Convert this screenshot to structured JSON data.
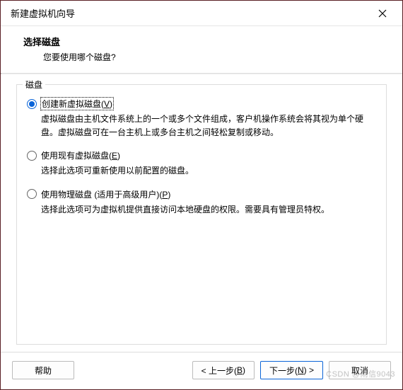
{
  "window": {
    "title": "新建虚拟机向导"
  },
  "header": {
    "title": "选择磁盘",
    "subtitle": "您要使用哪个磁盘?"
  },
  "group": {
    "label": "磁盘"
  },
  "options": [
    {
      "label_pre": "创建新虚拟磁盘(",
      "label_accel": "V",
      "label_post": ")",
      "selected": true,
      "desc": "虚拟磁盘由主机文件系统上的一个或多个文件组成，客户机操作系统会将其视为单个硬盘。虚拟磁盘可在一台主机上或多台主机之间轻松复制或移动。"
    },
    {
      "label_pre": "使用现有虚拟磁盘(",
      "label_accel": "E",
      "label_post": ")",
      "selected": false,
      "desc": "选择此选项可重新使用以前配置的磁盘。"
    },
    {
      "label_pre": "使用物理磁盘 (适用于高级用户)(",
      "label_accel": "P",
      "label_post": ")",
      "selected": false,
      "desc": "选择此选项可为虚拟机提供直接访问本地硬盘的权限。需要具有管理员特权。"
    }
  ],
  "buttons": {
    "help": "帮助",
    "back_pre": "< 上一步(",
    "back_accel": "B",
    "back_post": ")",
    "next_pre": "下一步(",
    "next_accel": "N",
    "next_post": ") >",
    "cancel": "取消"
  },
  "watermark": "CSDN @雨信9043"
}
